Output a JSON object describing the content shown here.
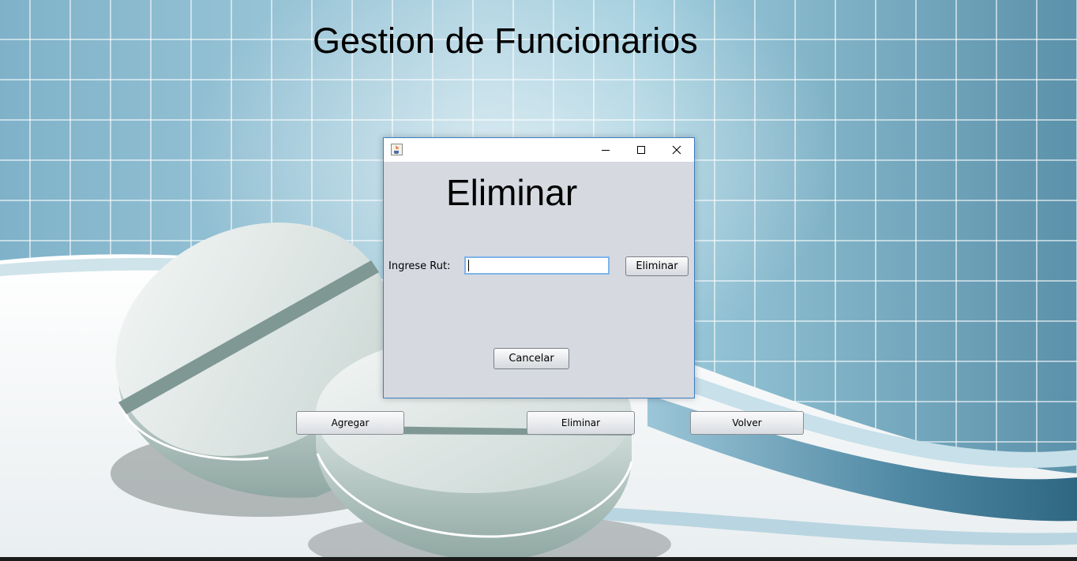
{
  "app": {
    "title": "Gestion de Funcionarios"
  },
  "main_buttons": {
    "agregar": "Agregar",
    "eliminar": "Eliminar",
    "volver": "Volver"
  },
  "dialog": {
    "title": "",
    "heading": "Eliminar",
    "rut_label": "Ingrese Rut:",
    "rut_value": "",
    "eliminar_button": "Eliminar",
    "cancelar_button": "Cancelar"
  },
  "colors": {
    "dialog_border": "#3b7fc4",
    "dialog_background": "#d6d9e0",
    "input_focus_border": "#7eb4ea"
  },
  "icons": {
    "dialog_icon": "java-coffee-icon",
    "minimize": "minimize-icon",
    "maximize": "maximize-icon",
    "close": "close-icon"
  }
}
